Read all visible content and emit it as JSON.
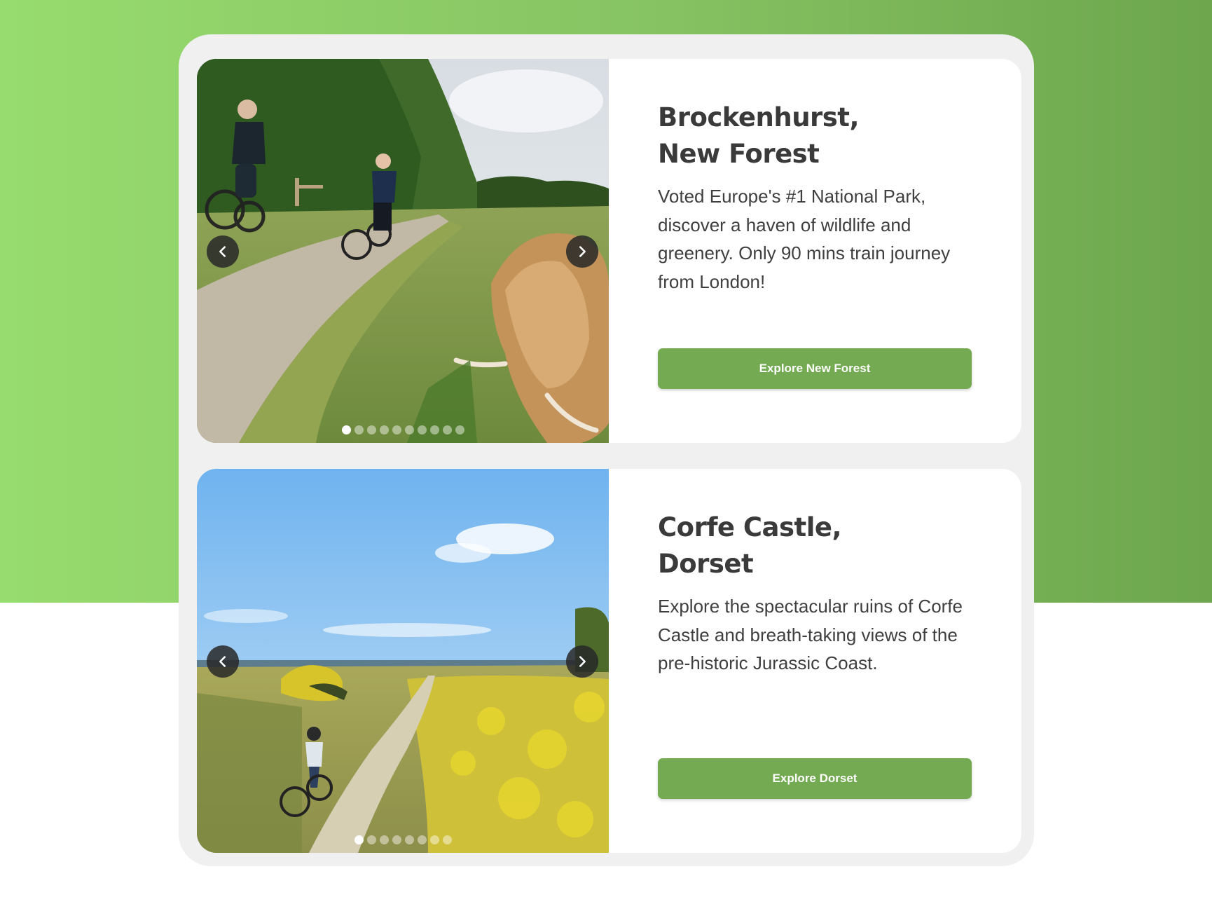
{
  "background": {
    "gradient_start": "#97dc6e",
    "gradient_end": "#6da64d",
    "panel": "#f0f0f0"
  },
  "accent": "#74ab52",
  "destinations": [
    {
      "title_line1": "Brockenhurst,",
      "title_line2": "New Forest",
      "description": "Voted Europe's #1 National Park, discover a haven of wildlife and greenery. Only 90 mins train journey from London!",
      "cta_label": "Explore New Forest",
      "image_subject": "cyclists-and-highland-cow",
      "slides": {
        "total": 10,
        "current": 1
      }
    },
    {
      "title_line1": "Corfe Castle,",
      "title_line2": "Dorset",
      "description": "Explore the spectacular ruins of Corfe Castle and breath-taking views of the pre-historic Jurassic Coast.",
      "cta_label": "Explore Dorset",
      "image_subject": "cyclist-on-heathland-trail",
      "slides": {
        "total": 8,
        "current": 1
      }
    }
  ],
  "icons": {
    "prev": "chevron-left-icon",
    "next": "chevron-right-icon"
  }
}
